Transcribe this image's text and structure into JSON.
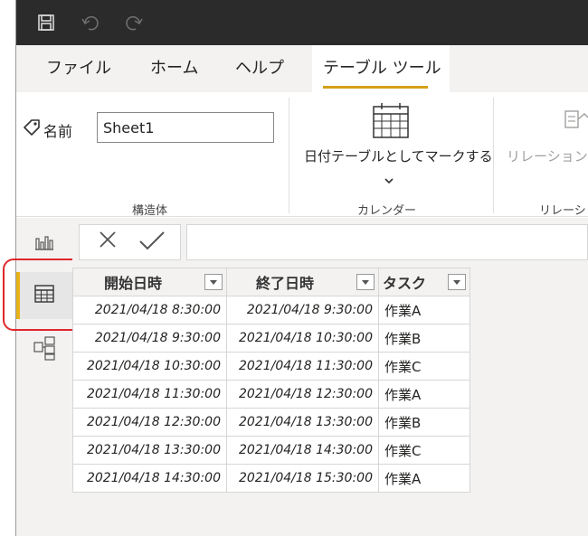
{
  "quick_access": {
    "save_icon": "save-icon",
    "undo_icon": "undo-icon",
    "redo_icon": "redo-icon"
  },
  "tabs": [
    {
      "label": "ファイル"
    },
    {
      "label": "ホーム"
    },
    {
      "label": "ヘルプ"
    },
    {
      "label": "テーブル ツール",
      "active": true
    }
  ],
  "ribbon": {
    "structure": {
      "name_label": "名前",
      "name_value": "Sheet1",
      "group_label": "構造体"
    },
    "calendar": {
      "mark_date_label": "日付テーブルとしてマークする",
      "group_label": "カレンダー"
    },
    "relationships": {
      "button_label": "リレーションシ",
      "group_label": "リレーショ"
    }
  },
  "rail": {
    "items": [
      "report-view",
      "data-view",
      "model-view"
    ],
    "active": "data-view",
    "accent_color": "#e8b21a",
    "highlight_color": "#e0272b"
  },
  "formula_bar": {
    "cancel_icon": "close-icon",
    "commit_icon": "check-icon",
    "value": ""
  },
  "table": {
    "columns": [
      "開始日時",
      "終了日時",
      "タスク"
    ],
    "rows": [
      [
        "2021/04/18 8:30:00",
        "2021/04/18 9:30:00",
        "作業A"
      ],
      [
        "2021/04/18 9:30:00",
        "2021/04/18 10:30:00",
        "作業B"
      ],
      [
        "2021/04/18 10:30:00",
        "2021/04/18 11:30:00",
        "作業C"
      ],
      [
        "2021/04/18 11:30:00",
        "2021/04/18 12:30:00",
        "作業A"
      ],
      [
        "2021/04/18 12:30:00",
        "2021/04/18 13:30:00",
        "作業B"
      ],
      [
        "2021/04/18 13:30:00",
        "2021/04/18 14:30:00",
        "作業C"
      ],
      [
        "2021/04/18 14:30:00",
        "2021/04/18 15:30:00",
        "作業A"
      ]
    ]
  }
}
